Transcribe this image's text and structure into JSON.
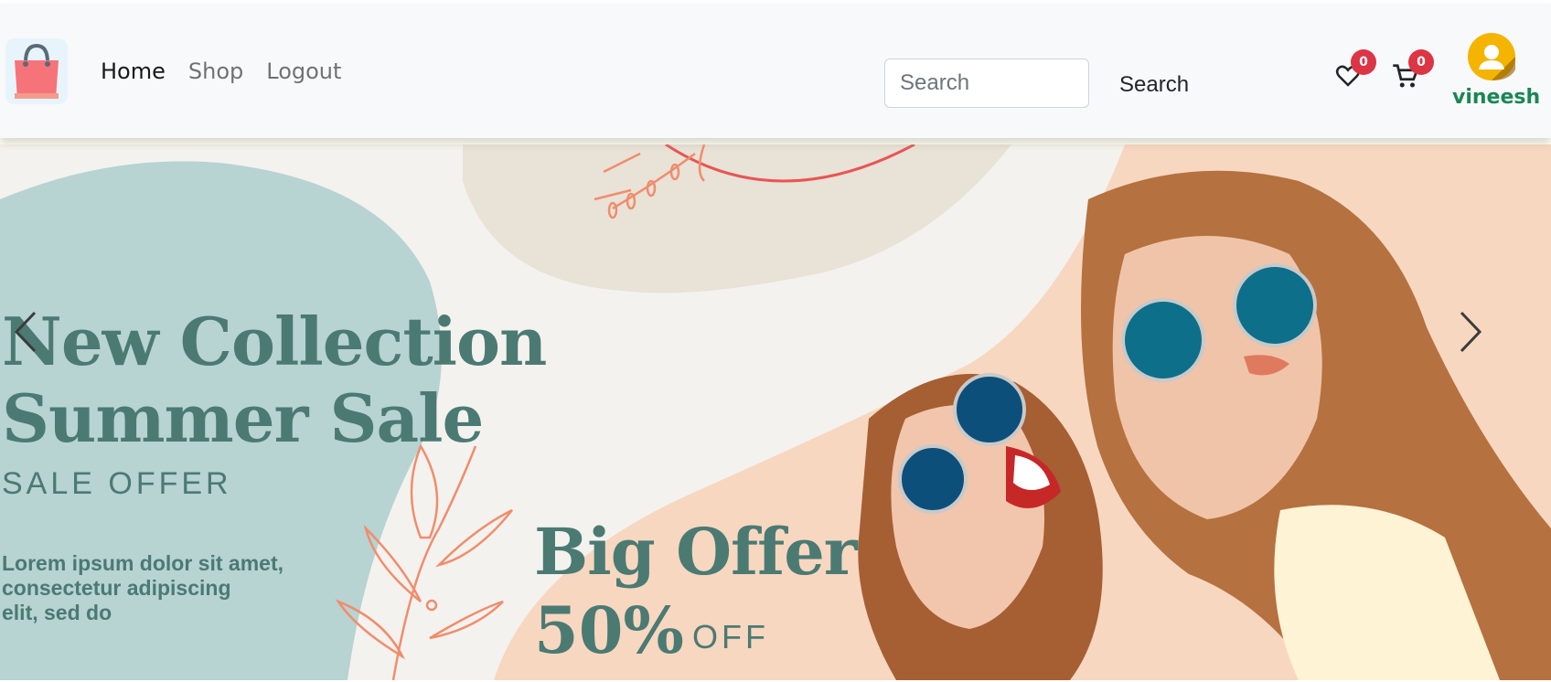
{
  "navbar": {
    "logo_icon": "shopping-bag-icon",
    "links": [
      {
        "label": "Home",
        "active": true
      },
      {
        "label": "Shop",
        "active": false
      },
      {
        "label": "Logout",
        "active": false
      }
    ],
    "search": {
      "placeholder": "Search",
      "value": "",
      "button_label": "Search"
    },
    "wishlist": {
      "icon": "heart-icon",
      "count": "0"
    },
    "cart": {
      "icon": "cart-icon",
      "count": "0"
    },
    "user": {
      "avatar_icon": "user-avatar-icon",
      "name": "vineesh"
    }
  },
  "hero": {
    "title_line1": "New Collection",
    "title_line2": "Summer Sale",
    "subtitle": "SALE OFFER",
    "body_line1": "Lorem ipsum dolor sit amet,",
    "body_line2": "consectetur adipiscing",
    "body_line3": "elit, sed do",
    "offer_title": "Big Offer",
    "offer_percent": "50%",
    "offer_suffix": "OFF",
    "prev_icon": "chevron-left-icon",
    "next_icon": "chevron-right-icon"
  },
  "colors": {
    "accent_text": "#4b7a73",
    "badge": "#dc3545",
    "username": "#198754",
    "blob_teal": "#b7d3d2",
    "blob_peach": "#f7d7c0",
    "leaf": "#f08d6d"
  }
}
